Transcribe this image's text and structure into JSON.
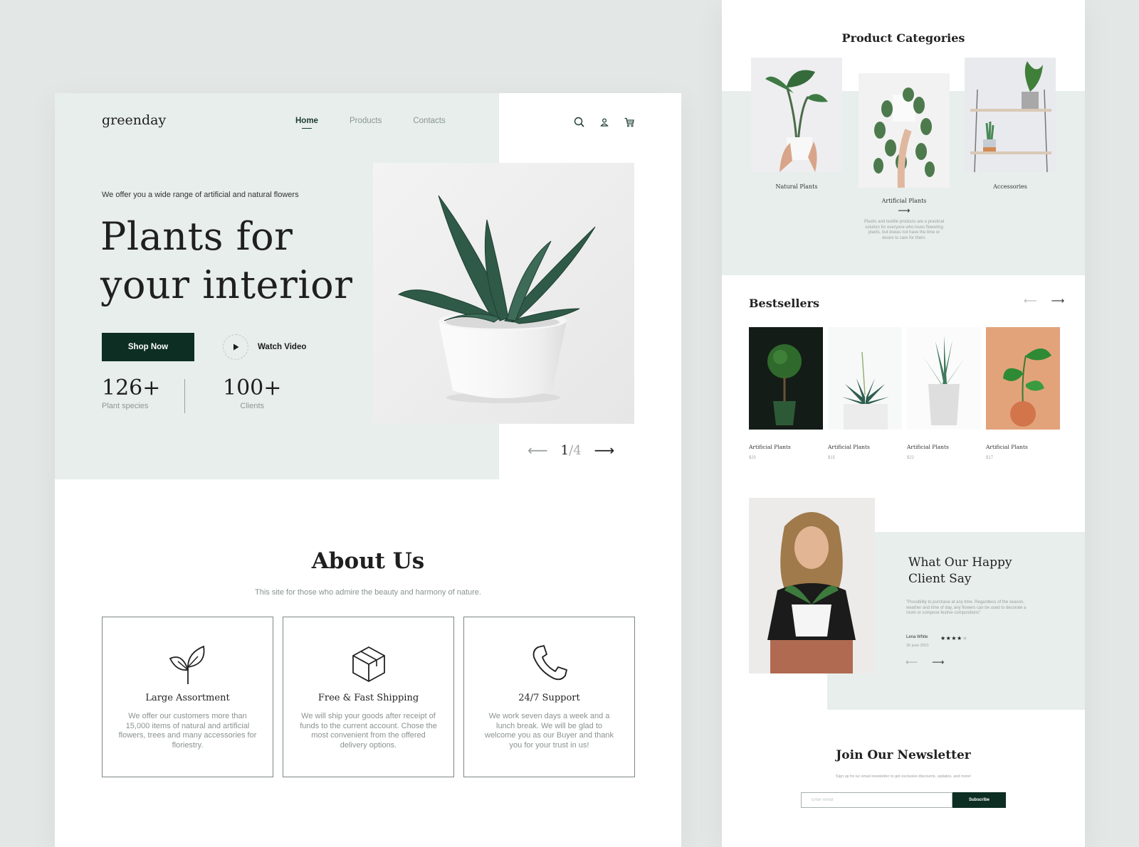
{
  "brand": {
    "logo": "greenday",
    "accent": "#0d2e22",
    "tint": "#e7eeec"
  },
  "nav": {
    "items": [
      {
        "label": "Home",
        "active": true
      },
      {
        "label": "Products",
        "active": false
      },
      {
        "label": "Contacts",
        "active": false
      }
    ],
    "icons": [
      "search-icon",
      "user-icon",
      "cart-icon"
    ]
  },
  "hero": {
    "subtitle": "We offer you a wide range of artificial and natural flowers",
    "title_line1": "Plants for",
    "title_line2": "your interior",
    "shop_label": "Shop Now",
    "watch_label": "Watch Video",
    "stats": [
      {
        "value": "126+",
        "label": "Plant species"
      },
      {
        "value": "100+",
        "label": "Clients"
      }
    ],
    "slider": {
      "current": "1",
      "total": "/4"
    }
  },
  "about": {
    "title": "About Us",
    "subtitle": "This site for those who admire the beauty and harmony of nature.",
    "cards": [
      {
        "icon": "sprout-icon",
        "title": "Large Assortment",
        "text": "We offer our customers more than 15,000 items of natural and artificial flowers, trees and many accessories for floriestry."
      },
      {
        "icon": "box-icon",
        "title": "Free & Fast Shipping",
        "text": "We will ship your goods after receipt of funds to the current account. Chose the most convenient from the offered delivery options."
      },
      {
        "icon": "phone-icon",
        "title": "24/7 Support",
        "text": "We work seven days a week and a lunch break. We will be glad to welcome you as our Buyer and thank you for your trust in us!"
      }
    ]
  },
  "categories": {
    "title": "Product Categories",
    "items": [
      {
        "name": "Natural Plants"
      },
      {
        "name": "Artificial Plants",
        "description": "Plastic and textille products are a practical solution for everyone who loves flowering plants, but doeas not have the time or desire to care for them."
      },
      {
        "name": "Accessories"
      }
    ]
  },
  "bestsellers": {
    "title": "Bestsellers",
    "items": [
      {
        "name": "Artificial Plants",
        "price": "$20"
      },
      {
        "name": "Artificial Plants",
        "price": "$15"
      },
      {
        "name": "Artificial Plants",
        "price": "$22"
      },
      {
        "name": "Artificial Plants",
        "price": "$17"
      }
    ]
  },
  "testimonial": {
    "title_line1": "What Our Happy",
    "title_line2": "Client Say",
    "quote": "\"Possibility to purchase at any time. Regardless of the season, weather and time of day, any flowers can be used to decorate a room or compose festive compositions\"",
    "author": "Lena White",
    "date": "30 june 2021",
    "rating": 4,
    "rating_max": 5
  },
  "newsletter": {
    "title": "Join Our Newsletter",
    "subtitle": "Sign up for iur email newsletter to get exclusive discounts, updates, and more!",
    "placeholder": "Enter email",
    "button": "Subscribe"
  }
}
